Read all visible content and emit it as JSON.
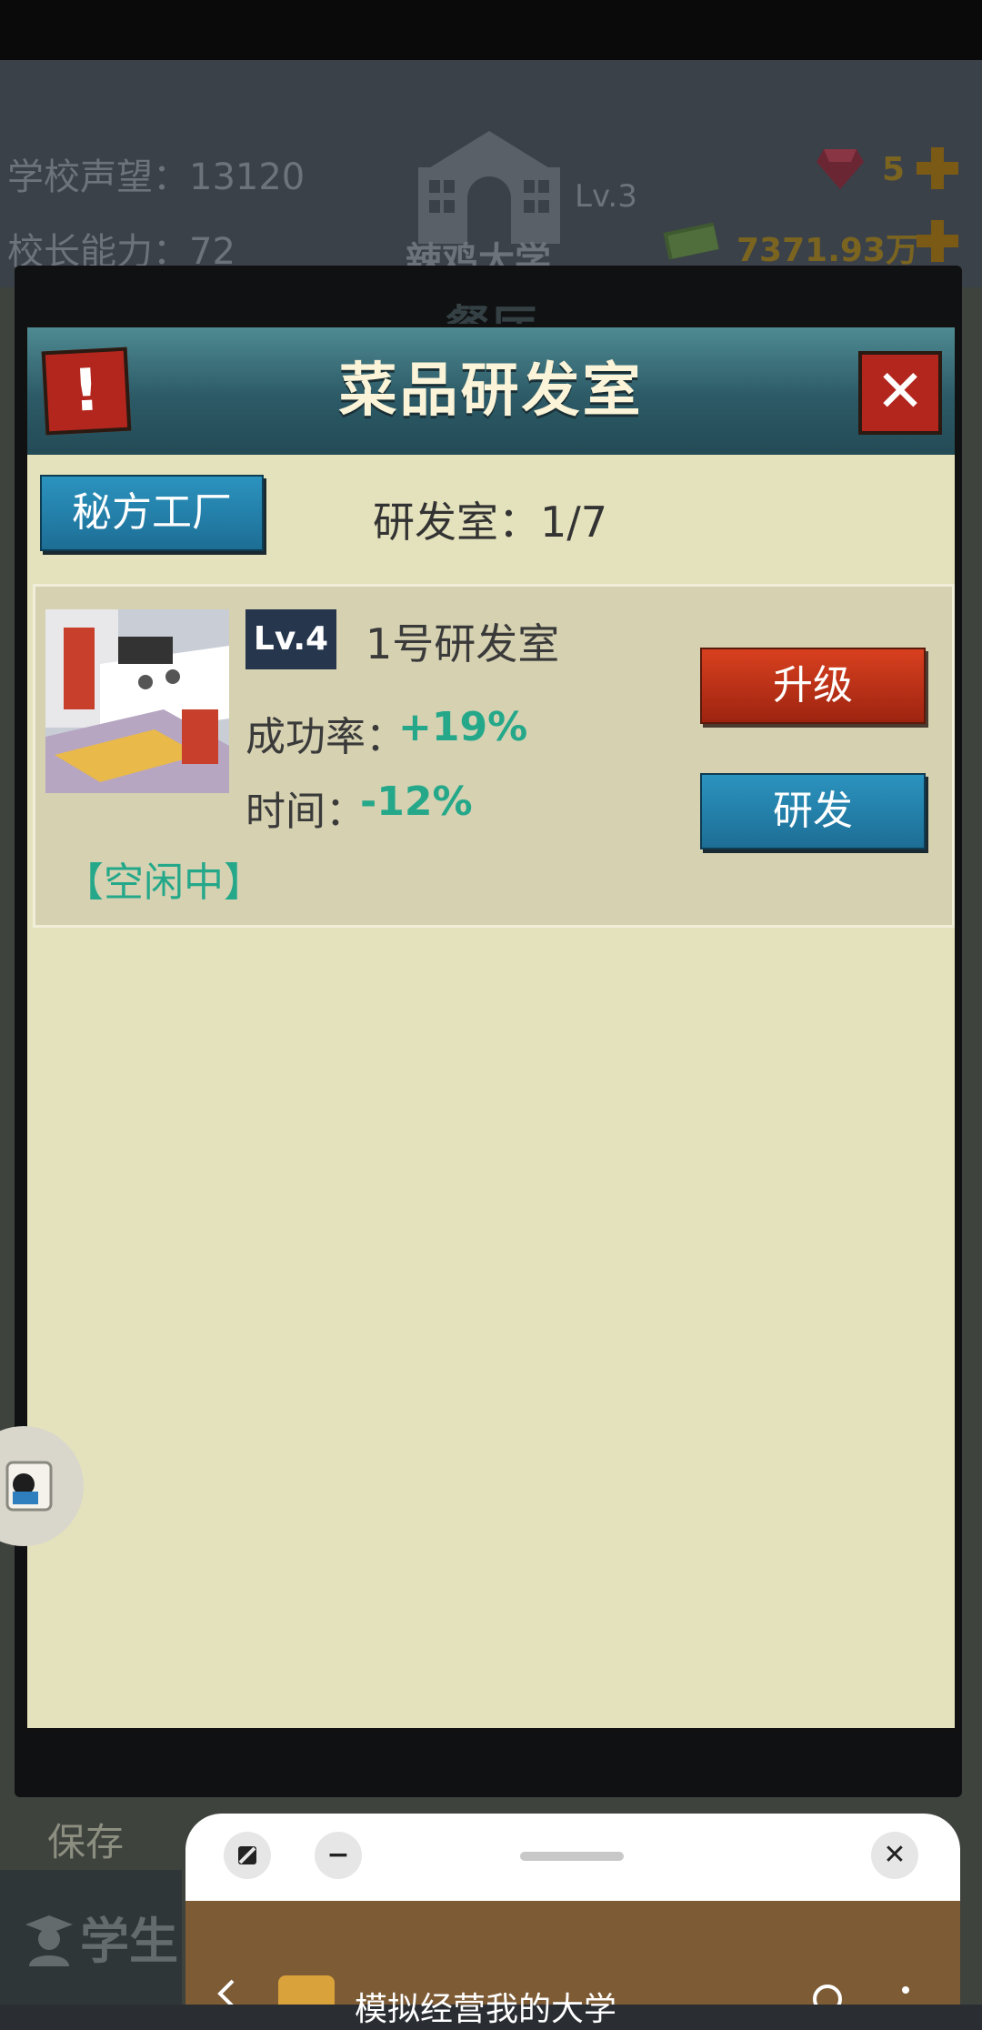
{
  "hud": {
    "reputation": "学校声望：13120",
    "ability": "校长能力：72",
    "school_level": "Lv.3",
    "school_name": "辣鸡大学",
    "gems": "5",
    "money": "7371.93万"
  },
  "back_panel": {
    "title": "餐厅"
  },
  "dialog": {
    "title": "菜品研发室",
    "warning_glyph": "!",
    "close_glyph": "✕",
    "recipe_factory_label": "秘方工厂",
    "lab_count": "研发室：1/7"
  },
  "lab": {
    "level": "Lv.4",
    "name": "1号研发室",
    "success_label": "成功率：",
    "success_value": "+19%",
    "time_label": "时间：",
    "time_value": "-12%",
    "status": "【空闲中】",
    "upgrade_label": "升级",
    "research_label": "研发"
  },
  "bottom": {
    "save_label": "保存",
    "student_label": "学生"
  },
  "floating_window": {
    "app_title": "模拟经营我的大学",
    "minimize_glyph": "−",
    "close_glyph": "✕"
  },
  "colors": {
    "accent_green": "#25a88a",
    "button_blue": "#1d6e95",
    "button_red": "#b2261d",
    "panel_bg": "#e4e2bc"
  }
}
